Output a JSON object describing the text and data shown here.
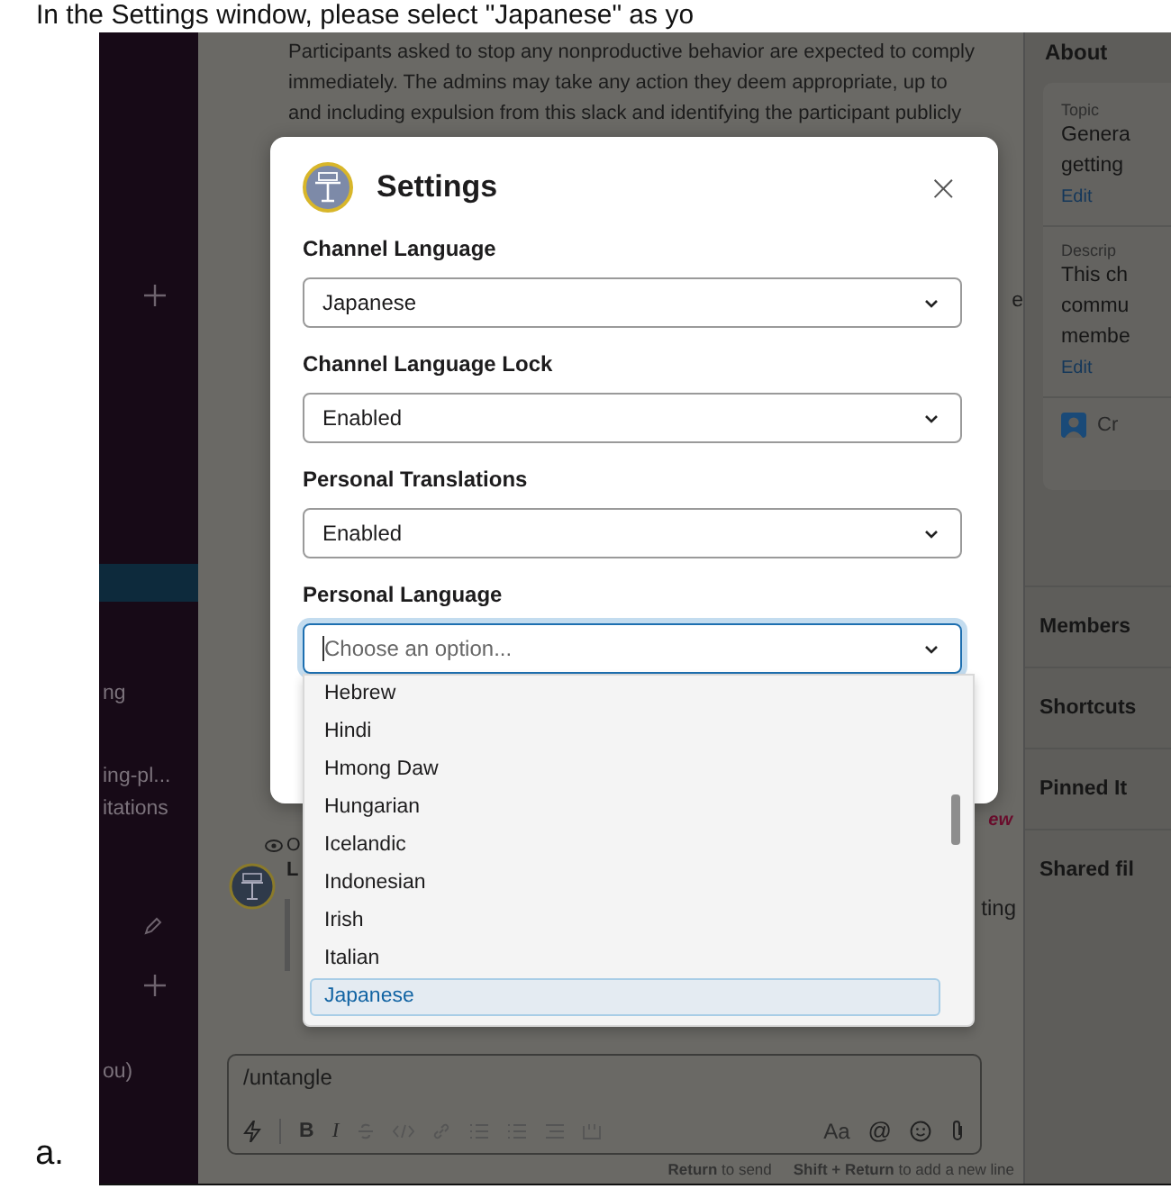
{
  "caption": "In the Settings window, please select \"Japanese\" as yo",
  "figure_label": "a.",
  "sidebar": {
    "items": [
      {
        "label": "ng"
      },
      {
        "label": "ing-pl..."
      },
      {
        "label": "itations"
      },
      {
        "label": "ou)"
      }
    ]
  },
  "main": {
    "paragraph_lines": [
      "Participants asked to stop any nonproductive behavior are expected to comply",
      "immediately. The admins may take any action they deem appropriate, up to",
      "and including expulsion from this slack and identifying the participant publicly"
    ],
    "edge_text": "e",
    "new_marker": "ew",
    "visibility_text": "O",
    "author": "L",
    "message_end": "ting",
    "composer": {
      "value": "/untangle",
      "format_left": [
        "B",
        "I"
      ],
      "format_right": [
        "Aa",
        "@"
      ]
    },
    "hints": [
      "**Return** to send",
      "**Shift + Return** to add a new line"
    ]
  },
  "right_panel": {
    "title": "About",
    "topic_label": "Topic",
    "topic_lines": [
      "Genera",
      "getting"
    ],
    "topic_edit": "Edit",
    "description_label": "Descrip",
    "description_lines": [
      "This ch",
      "commu",
      "membe"
    ],
    "description_edit": "Edit",
    "creator": "Cr",
    "sections": [
      "Members",
      "Shortcuts",
      "Pinned It",
      "Shared fil"
    ]
  },
  "modal": {
    "title": "Settings",
    "close": "×",
    "fields": [
      {
        "label": "Channel Language",
        "value": "Japanese",
        "focused": false
      },
      {
        "label": "Channel Language Lock",
        "value": "Enabled",
        "focused": false
      },
      {
        "label": "Personal Translations",
        "value": "Enabled",
        "focused": false
      },
      {
        "label": "Personal Language",
        "placeholder": "Choose an option...",
        "focused": true
      }
    ],
    "options": [
      {
        "label": "Hebrew",
        "selected": false
      },
      {
        "label": "Hindi",
        "selected": false
      },
      {
        "label": "Hmong Daw",
        "selected": false
      },
      {
        "label": "Hungarian",
        "selected": false
      },
      {
        "label": "Icelandic",
        "selected": false
      },
      {
        "label": "Indonesian",
        "selected": false
      },
      {
        "label": "Irish",
        "selected": false
      },
      {
        "label": "Italian",
        "selected": false
      },
      {
        "label": "Japanese",
        "selected": true
      }
    ]
  }
}
